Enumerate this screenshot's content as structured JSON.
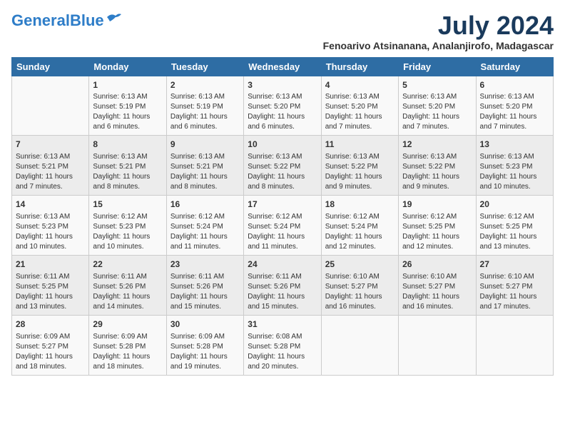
{
  "logo": {
    "line1": "General",
    "line2": "Blue"
  },
  "title": "July 2024",
  "location": "Fenoarivo Atsinanana, Analanjirofo, Madagascar",
  "weekdays": [
    "Sunday",
    "Monday",
    "Tuesday",
    "Wednesday",
    "Thursday",
    "Friday",
    "Saturday"
  ],
  "weeks": [
    [
      {
        "day": "",
        "info": ""
      },
      {
        "day": "1",
        "info": "Sunrise: 6:13 AM\nSunset: 5:19 PM\nDaylight: 11 hours\nand 6 minutes."
      },
      {
        "day": "2",
        "info": "Sunrise: 6:13 AM\nSunset: 5:19 PM\nDaylight: 11 hours\nand 6 minutes."
      },
      {
        "day": "3",
        "info": "Sunrise: 6:13 AM\nSunset: 5:20 PM\nDaylight: 11 hours\nand 6 minutes."
      },
      {
        "day": "4",
        "info": "Sunrise: 6:13 AM\nSunset: 5:20 PM\nDaylight: 11 hours\nand 7 minutes."
      },
      {
        "day": "5",
        "info": "Sunrise: 6:13 AM\nSunset: 5:20 PM\nDaylight: 11 hours\nand 7 minutes."
      },
      {
        "day": "6",
        "info": "Sunrise: 6:13 AM\nSunset: 5:20 PM\nDaylight: 11 hours\nand 7 minutes."
      }
    ],
    [
      {
        "day": "7",
        "info": "Sunrise: 6:13 AM\nSunset: 5:21 PM\nDaylight: 11 hours\nand 7 minutes."
      },
      {
        "day": "8",
        "info": "Sunrise: 6:13 AM\nSunset: 5:21 PM\nDaylight: 11 hours\nand 8 minutes."
      },
      {
        "day": "9",
        "info": "Sunrise: 6:13 AM\nSunset: 5:21 PM\nDaylight: 11 hours\nand 8 minutes."
      },
      {
        "day": "10",
        "info": "Sunrise: 6:13 AM\nSunset: 5:22 PM\nDaylight: 11 hours\nand 8 minutes."
      },
      {
        "day": "11",
        "info": "Sunrise: 6:13 AM\nSunset: 5:22 PM\nDaylight: 11 hours\nand 9 minutes."
      },
      {
        "day": "12",
        "info": "Sunrise: 6:13 AM\nSunset: 5:22 PM\nDaylight: 11 hours\nand 9 minutes."
      },
      {
        "day": "13",
        "info": "Sunrise: 6:13 AM\nSunset: 5:23 PM\nDaylight: 11 hours\nand 10 minutes."
      }
    ],
    [
      {
        "day": "14",
        "info": "Sunrise: 6:13 AM\nSunset: 5:23 PM\nDaylight: 11 hours\nand 10 minutes."
      },
      {
        "day": "15",
        "info": "Sunrise: 6:12 AM\nSunset: 5:23 PM\nDaylight: 11 hours\nand 10 minutes."
      },
      {
        "day": "16",
        "info": "Sunrise: 6:12 AM\nSunset: 5:24 PM\nDaylight: 11 hours\nand 11 minutes."
      },
      {
        "day": "17",
        "info": "Sunrise: 6:12 AM\nSunset: 5:24 PM\nDaylight: 11 hours\nand 11 minutes."
      },
      {
        "day": "18",
        "info": "Sunrise: 6:12 AM\nSunset: 5:24 PM\nDaylight: 11 hours\nand 12 minutes."
      },
      {
        "day": "19",
        "info": "Sunrise: 6:12 AM\nSunset: 5:25 PM\nDaylight: 11 hours\nand 12 minutes."
      },
      {
        "day": "20",
        "info": "Sunrise: 6:12 AM\nSunset: 5:25 PM\nDaylight: 11 hours\nand 13 minutes."
      }
    ],
    [
      {
        "day": "21",
        "info": "Sunrise: 6:11 AM\nSunset: 5:25 PM\nDaylight: 11 hours\nand 13 minutes."
      },
      {
        "day": "22",
        "info": "Sunrise: 6:11 AM\nSunset: 5:26 PM\nDaylight: 11 hours\nand 14 minutes."
      },
      {
        "day": "23",
        "info": "Sunrise: 6:11 AM\nSunset: 5:26 PM\nDaylight: 11 hours\nand 15 minutes."
      },
      {
        "day": "24",
        "info": "Sunrise: 6:11 AM\nSunset: 5:26 PM\nDaylight: 11 hours\nand 15 minutes."
      },
      {
        "day": "25",
        "info": "Sunrise: 6:10 AM\nSunset: 5:27 PM\nDaylight: 11 hours\nand 16 minutes."
      },
      {
        "day": "26",
        "info": "Sunrise: 6:10 AM\nSunset: 5:27 PM\nDaylight: 11 hours\nand 16 minutes."
      },
      {
        "day": "27",
        "info": "Sunrise: 6:10 AM\nSunset: 5:27 PM\nDaylight: 11 hours\nand 17 minutes."
      }
    ],
    [
      {
        "day": "28",
        "info": "Sunrise: 6:09 AM\nSunset: 5:27 PM\nDaylight: 11 hours\nand 18 minutes."
      },
      {
        "day": "29",
        "info": "Sunrise: 6:09 AM\nSunset: 5:28 PM\nDaylight: 11 hours\nand 18 minutes."
      },
      {
        "day": "30",
        "info": "Sunrise: 6:09 AM\nSunset: 5:28 PM\nDaylight: 11 hours\nand 19 minutes."
      },
      {
        "day": "31",
        "info": "Sunrise: 6:08 AM\nSunset: 5:28 PM\nDaylight: 11 hours\nand 20 minutes."
      },
      {
        "day": "",
        "info": ""
      },
      {
        "day": "",
        "info": ""
      },
      {
        "day": "",
        "info": ""
      }
    ]
  ]
}
